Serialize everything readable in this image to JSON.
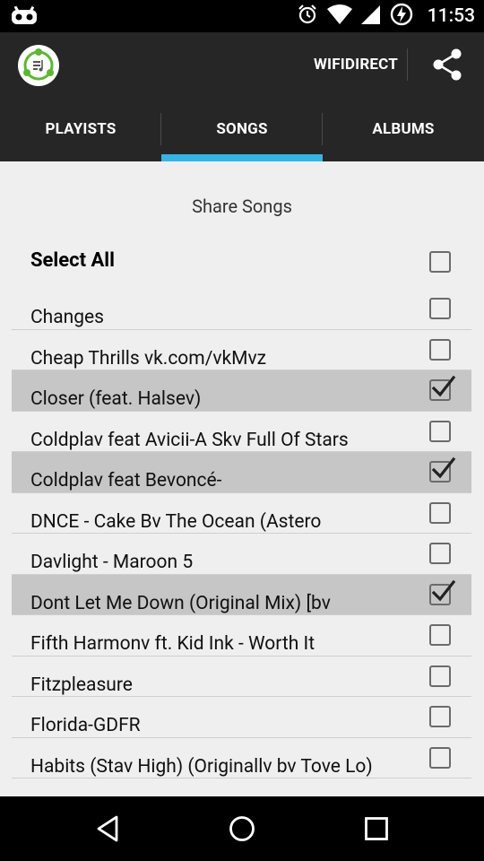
{
  "status_bar": {
    "time": "11:53",
    "icons": [
      "android-debug-icon",
      "alarm-icon",
      "wifi-icon",
      "signal-icon",
      "battery-charging-icon"
    ]
  },
  "action_bar": {
    "app_icon": "music-share-logo-icon",
    "wifidirect_label": "WIFIDIRECT",
    "share_icon": "share-icon"
  },
  "tabs": [
    {
      "label": "PLAYISTS",
      "selected": false
    },
    {
      "label": "SONGS",
      "selected": true
    },
    {
      "label": "ALBUMS",
      "selected": false
    }
  ],
  "colors": {
    "accent": "#33b5e5",
    "bar": "#262626",
    "selected_row": "#c6c6c6",
    "logo_green": "#5cb82f"
  },
  "main": {
    "title": "Share Songs",
    "select_all_label": "Select All",
    "select_all_checked": false
  },
  "songs": [
    {
      "title": "Changes",
      "checked": false
    },
    {
      "title": "Cheap Thrills vk.com/vkMvz",
      "checked": false
    },
    {
      "title": "Closer (feat. Halsev)",
      "checked": true
    },
    {
      "title": "Coldplav  feat  Avicii-A  Skv  Full  Of  Stars",
      "checked": false
    },
    {
      "title": "Coldplav  feat  Bevoncé-",
      "checked": true
    },
    {
      "title": "DNCE - Cake Bv The Ocean (Astero",
      "checked": false
    },
    {
      "title": "Davlight - Maroon 5",
      "checked": false
    },
    {
      "title": "Dont Let Me Down (Original Mix) [bv",
      "checked": true
    },
    {
      "title": "Fifth Harmonv ft. Kid Ink - Worth It",
      "checked": false
    },
    {
      "title": "Fitzpleasure",
      "checked": false
    },
    {
      "title": "Florida-GDFR",
      "checked": false
    },
    {
      "title": "Habits (Stav High) (Originallv bv Tove Lo)",
      "checked": false
    }
  ],
  "nav_bar": {
    "back_icon": "back-icon",
    "home_icon": "home-icon",
    "recents_icon": "recents-icon"
  }
}
